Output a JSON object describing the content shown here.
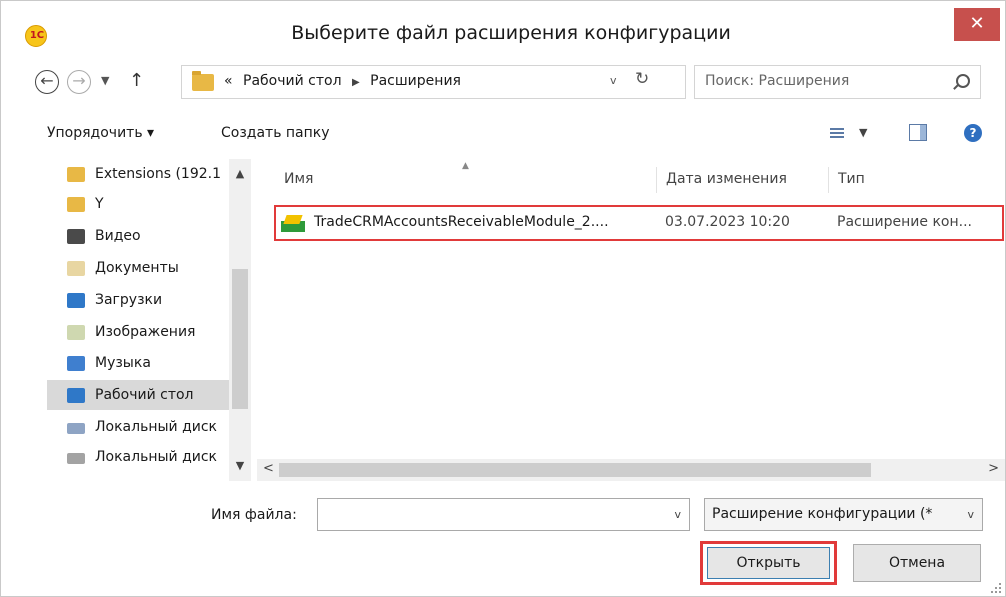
{
  "window": {
    "title": "Выберите файл расширения конфигурации",
    "logo_text": "1С",
    "close_glyph": "✕"
  },
  "nav": {
    "back_glyph": "←",
    "forward_glyph": "→",
    "up_glyph": "↑",
    "breadcrumb_prefix": "«",
    "breadcrumb": [
      "Рабочий стол",
      "Расширения"
    ],
    "search_placeholder": "Поиск: Расширения"
  },
  "toolbar": {
    "organize_label": "Упорядочить ▾",
    "new_folder_label": "Создать папку",
    "help_glyph": "?"
  },
  "tree": {
    "items": [
      {
        "label": "Extensions (192.1",
        "icon": "folder-icon"
      },
      {
        "label": "Y",
        "icon": "folder-icon"
      },
      {
        "label": "Видео",
        "icon": "video-folder-icon"
      },
      {
        "label": "Документы",
        "icon": "documents-folder-icon"
      },
      {
        "label": "Загрузки",
        "icon": "downloads-folder-icon"
      },
      {
        "label": "Изображения",
        "icon": "pictures-folder-icon"
      },
      {
        "label": "Музыка",
        "icon": "music-folder-icon"
      },
      {
        "label": "Рабочий стол",
        "icon": "desktop-folder-icon",
        "selected": true
      },
      {
        "label": "Локальный диск",
        "icon": "drive-icon"
      },
      {
        "label": "Локальный диск",
        "icon": "network-drive-icon"
      }
    ]
  },
  "list": {
    "columns": {
      "name": "Имя",
      "date": "Дата изменения",
      "type": "Тип"
    },
    "files": [
      {
        "name": "TradeCRMAccountsReceivableModule_2....",
        "date": "03.07.2023 10:20",
        "type": "Расширение кон..."
      }
    ]
  },
  "bottom": {
    "filename_label": "Имя файла:",
    "filename_value": "",
    "filetype_value": "Расширение конфигурации (*",
    "open_label": "Открыть",
    "cancel_label": "Отмена"
  },
  "colors": {
    "highlight": "#e13a3a",
    "close": "#c7504d",
    "selection": "#d9d9d9"
  }
}
